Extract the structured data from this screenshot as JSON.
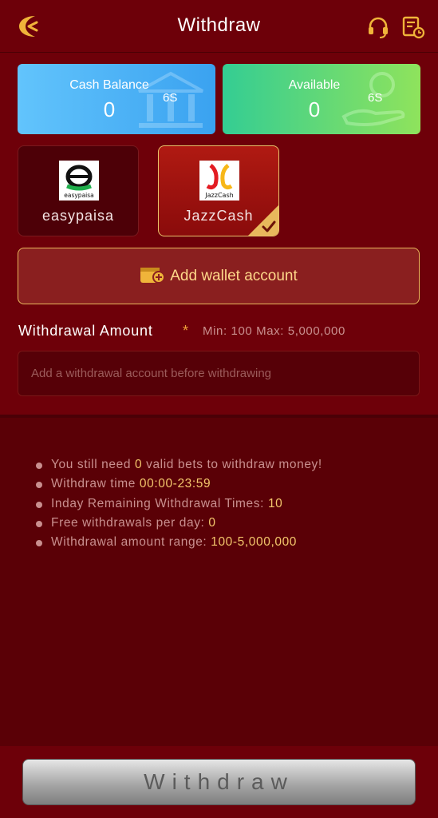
{
  "header": {
    "title": "Withdraw"
  },
  "balances": [
    {
      "label": "Cash Balance",
      "value": "0",
      "timer": "6S",
      "color": "#4db3f7"
    },
    {
      "label": "Available",
      "value": "0",
      "timer": "6S",
      "color": "#5ed77c"
    }
  ],
  "wallets": [
    {
      "name": "easypaisa",
      "logo_text": "easypaisa",
      "selected": false
    },
    {
      "name": "JazzCash",
      "logo_text": "JazzCash",
      "selected": true
    }
  ],
  "add_wallet": {
    "label": "Add wallet account"
  },
  "amount": {
    "label": "Withdrawal Amount",
    "required_mark": "*",
    "range": "Min: 100 Max: 5,000,000",
    "placeholder": "Add a withdrawal account before withdrawing"
  },
  "rules": [
    {
      "pre": "You still need ",
      "hl": "0",
      "post": " valid bets to withdraw money!"
    },
    {
      "pre": "Withdraw time ",
      "hl": "00:00-23:59",
      "post": ""
    },
    {
      "pre": "Inday Remaining Withdrawal Times: ",
      "hl": "10",
      "post": ""
    },
    {
      "pre": "Free withdrawals per day: ",
      "hl": "0",
      "post": ""
    },
    {
      "pre": "Withdrawal amount range: ",
      "hl": "100-5,000,000",
      "post": ""
    }
  ],
  "footer": {
    "withdraw_label": "Withdraw"
  },
  "colors": {
    "accent": "#f3c66c",
    "background": "#6e0009",
    "border_gold": "#e8b85c"
  },
  "icons": {
    "back": "back-arrow-icon",
    "support": "headset-icon",
    "records": "record-list-icon"
  }
}
